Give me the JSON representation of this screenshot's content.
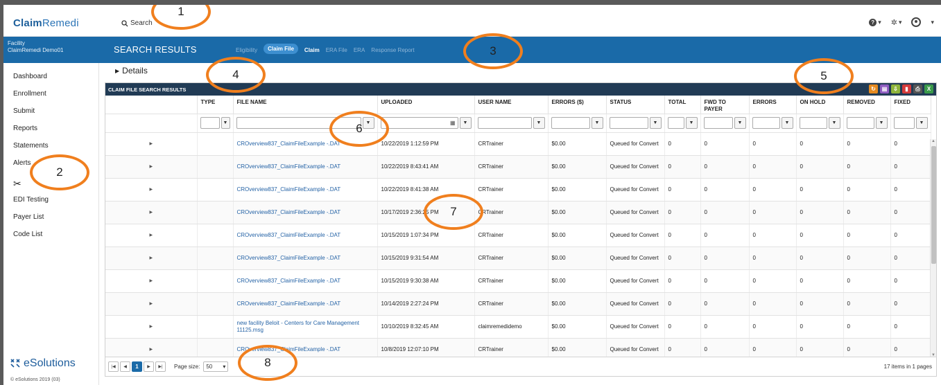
{
  "app": {
    "logo_bold": "Claim",
    "logo_thin": "Remedi",
    "search_label": "Search"
  },
  "facility": {
    "label": "Facility",
    "name": "ClaimRemedi Demo01"
  },
  "sidebar": {
    "items": [
      {
        "label": "Dashboard"
      },
      {
        "label": "Enrollment"
      },
      {
        "label": "Submit"
      },
      {
        "label": "Reports"
      },
      {
        "label": "Statements"
      },
      {
        "label": "Alerts"
      },
      {
        "label": "EDI Testing"
      },
      {
        "label": "Payer List"
      },
      {
        "label": "Code List"
      }
    ],
    "brand": "eSolutions",
    "copyright": "© eSolutions 2019 (03)"
  },
  "header": {
    "title": "SEARCH RESULTS",
    "tabs": [
      {
        "label": "Eligibility"
      },
      {
        "label": "Claim File"
      },
      {
        "label": "Claim"
      },
      {
        "label": "ERA File"
      },
      {
        "label": "ERA"
      },
      {
        "label": "Response Report"
      }
    ]
  },
  "details_label": "Details",
  "grid": {
    "title": "CLAIM FILE SEARCH RESULTS",
    "columns": [
      "",
      "TYPE",
      "FILE NAME",
      "UPLOADED",
      "USER NAME",
      "ERRORS ($)",
      "STATUS",
      "TOTAL",
      "FWD TO PAYER",
      "ERRORS",
      "ON HOLD",
      "REMOVED",
      "FIXED"
    ],
    "rows": [
      {
        "file": "CROverview837_ClaimFileExample -.DAT",
        "uploaded": "10/22/2019 1:12:59 PM",
        "user": "CRTrainer",
        "errors_amt": "$0.00",
        "status": "Queued for Convert",
        "total": "0",
        "fwd": "0",
        "errors": "0",
        "hold": "0",
        "removed": "0",
        "fixed": "0"
      },
      {
        "file": "CROverview837_ClaimFileExample -.DAT",
        "uploaded": "10/22/2019 8:43:41 AM",
        "user": "CRTrainer",
        "errors_amt": "$0.00",
        "status": "Queued for Convert",
        "total": "0",
        "fwd": "0",
        "errors": "0",
        "hold": "0",
        "removed": "0",
        "fixed": "0"
      },
      {
        "file": "CROverview837_ClaimFileExample -.DAT",
        "uploaded": "10/22/2019 8:41:38 AM",
        "user": "CRTrainer",
        "errors_amt": "$0.00",
        "status": "Queued for Convert",
        "total": "0",
        "fwd": "0",
        "errors": "0",
        "hold": "0",
        "removed": "0",
        "fixed": "0"
      },
      {
        "file": "CROverview837_ClaimFileExample -.DAT",
        "uploaded": "10/17/2019 2:36:25 PM",
        "user": "CRTrainer",
        "errors_amt": "$0.00",
        "status": "Queued for Convert",
        "total": "0",
        "fwd": "0",
        "errors": "0",
        "hold": "0",
        "removed": "0",
        "fixed": "0"
      },
      {
        "file": "CROverview837_ClaimFileExample -.DAT",
        "uploaded": "10/15/2019 1:07:34 PM",
        "user": "CRTrainer",
        "errors_amt": "$0.00",
        "status": "Queued for Convert",
        "total": "0",
        "fwd": "0",
        "errors": "0",
        "hold": "0",
        "removed": "0",
        "fixed": "0"
      },
      {
        "file": "CROverview837_ClaimFileExample -.DAT",
        "uploaded": "10/15/2019 9:31:54 AM",
        "user": "CRTrainer",
        "errors_amt": "$0.00",
        "status": "Queued for Convert",
        "total": "0",
        "fwd": "0",
        "errors": "0",
        "hold": "0",
        "removed": "0",
        "fixed": "0"
      },
      {
        "file": "CROverview837_ClaimFileExample -.DAT",
        "uploaded": "10/15/2019 9:30:38 AM",
        "user": "CRTrainer",
        "errors_amt": "$0.00",
        "status": "Queued for Convert",
        "total": "0",
        "fwd": "0",
        "errors": "0",
        "hold": "0",
        "removed": "0",
        "fixed": "0"
      },
      {
        "file": "CROverview837_ClaimFileExample -.DAT",
        "uploaded": "10/14/2019 2:27:24 PM",
        "user": "CRTrainer",
        "errors_amt": "$0.00",
        "status": "Queued for Convert",
        "total": "0",
        "fwd": "0",
        "errors": "0",
        "hold": "0",
        "removed": "0",
        "fixed": "0"
      },
      {
        "file": "new facility Beloit - Centers for Care Management 11125.msg",
        "uploaded": "10/10/2019 8:32:45 AM",
        "user": "claimremedidemo",
        "errors_amt": "$0.00",
        "status": "Queued for Convert",
        "total": "0",
        "fwd": "0",
        "errors": "0",
        "hold": "0",
        "removed": "0",
        "fixed": "0"
      },
      {
        "file": "CROverview837_ClaimFileExample -.DAT",
        "uploaded": "10/8/2019 12:07:10 PM",
        "user": "CRTrainer",
        "errors_amt": "$0.00",
        "status": "Queued for Convert",
        "total": "0",
        "fwd": "0",
        "errors": "0",
        "hold": "0",
        "removed": "0",
        "fixed": "0"
      }
    ]
  },
  "pager": {
    "current_page": "1",
    "page_size_label": "Page size:",
    "page_size": "50",
    "info": "17 items in 1 pages"
  },
  "annotations": [
    "1",
    "2",
    "3",
    "4",
    "5",
    "6",
    "7",
    "8"
  ],
  "colors": {
    "brand_blue": "#1a6aa8",
    "grid_header": "#213b55",
    "annotation": "#f07f1e",
    "link": "#2563a6"
  }
}
